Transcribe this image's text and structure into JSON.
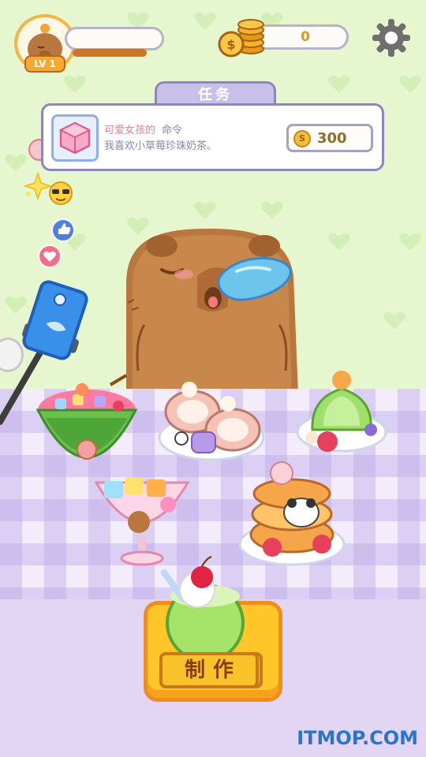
{
  "player": {
    "level_label": "LV 1"
  },
  "coins": {
    "value": "0"
  },
  "task": {
    "tab_title": "任务",
    "customer": "可爱女孩的",
    "order_word": "命令",
    "description": "我喜欢小草莓珍珠奶茶。",
    "reward_value": "300",
    "reward_coin_symbol": "S"
  },
  "actions": {
    "make_label": "制作"
  },
  "watermark": "ITMOP.COM",
  "icons": {
    "avatar": "capybara-avatar-icon",
    "coin_stack": "coin-stack-icon",
    "settings": "gear-icon",
    "task": "pink-cube-icon",
    "reactions": [
      "heart-icon",
      "sparkle-icon",
      "sunglasses-emoji-icon",
      "thumbs-up-icon",
      "heart-icon"
    ],
    "camera": "camera-icon"
  },
  "colors": {
    "background": "#e6f6cf",
    "table_check": "#beaae8",
    "button": "#ffc629",
    "button_border": "#f08d1c",
    "capybara": "#b9763e",
    "accent_pink": "#f27c99",
    "text_purple": "#8b83b8"
  },
  "items": [
    {
      "name": "watermelon-fruit-bowl"
    },
    {
      "name": "strawberry-roll-cake"
    },
    {
      "name": "green-jelly-dessert"
    },
    {
      "name": "fruit-jelly-parfait"
    },
    {
      "name": "panda-pancake-stack"
    },
    {
      "name": "green-melon-soda"
    }
  ]
}
